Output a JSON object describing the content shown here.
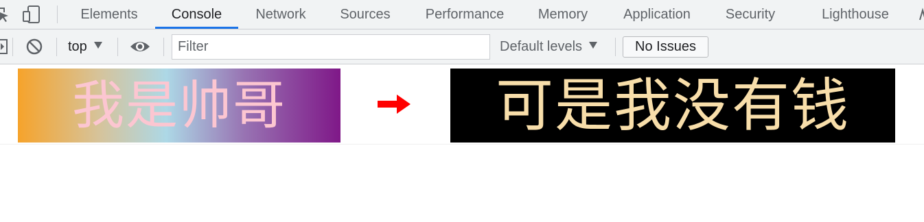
{
  "tabbar": {
    "tabs": [
      {
        "label": "Elements"
      },
      {
        "label": "Console",
        "active": true
      },
      {
        "label": "Network"
      },
      {
        "label": "Sources"
      },
      {
        "label": "Performance"
      },
      {
        "label": "Memory"
      },
      {
        "label": "Application"
      },
      {
        "label": "Security"
      },
      {
        "label": "Lighthouse"
      }
    ],
    "icons": [
      "inspect-element-icon",
      "device-toolbar-icon",
      "more-tabs-icon"
    ]
  },
  "toolbar": {
    "context": "top",
    "filter_placeholder": "Filter",
    "filter_value": "",
    "levels": "Default levels",
    "issues": "No Issues",
    "icons": [
      "show-sidebar-icon",
      "clear-console-icon",
      "context-dropdown-icon",
      "live-expression-eye-icon",
      "levels-dropdown-icon"
    ]
  },
  "console": {
    "left_banner": {
      "text": "我是帅哥",
      "text_color": "#fcc6d1",
      "gradient": [
        "#f6a32b",
        "#add8e6",
        "#7f1888"
      ]
    },
    "arrow": {
      "icon": "right-arrow-icon",
      "color": "#ff0000"
    },
    "right_banner": {
      "text": "可是我没有钱",
      "text_color": "#f8deaa",
      "background": "#000000"
    }
  },
  "colors": {
    "toolbar_bg": "#f1f3f4",
    "active_tab_underline": "#1a73e8",
    "tab_text": "#5f6368"
  }
}
